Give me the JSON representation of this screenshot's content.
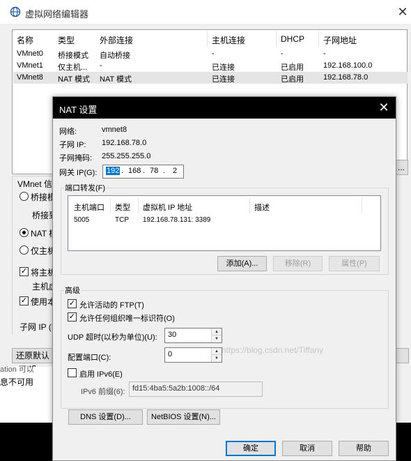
{
  "bg": {
    "title": "虚拟网络编辑器",
    "close": "✕",
    "columns": [
      "名称",
      "类型",
      "外部连接",
      "主机连接",
      "DHCP",
      "子网地址"
    ],
    "rows": [
      [
        "VMnet0",
        "桥接模式",
        "自动桥接",
        "-",
        "-",
        "-"
      ],
      [
        "VMnet1",
        "仅主机...",
        "-",
        "已连接",
        "已启用",
        "192.168.100.0"
      ],
      [
        "VMnet8",
        "NAT 模式",
        "NAT 模式",
        "已连接",
        "已启用",
        "192.168.78.0"
      ]
    ],
    "group_label": "VMnet 信息",
    "radio_bridge": "桥接模",
    "bridge_to": "桥接到",
    "radio_nat": "NAT 模",
    "radio_hostonly": "仅主机",
    "check_host": "将主机",
    "host_line2": "主机虚",
    "check_use": "使用本",
    "subnet_ip": "子网 IP (I",
    "restore_btn": "还原默认设",
    "left_partial": "ation 可以",
    "unavailable": "息不可用",
    "dots_btn": "..."
  },
  "nat": {
    "title": "NAT 设置",
    "close": "✕",
    "network_label": "网络:",
    "network_value": "vmnet8",
    "subnet_ip_label": "子网 IP:",
    "subnet_ip_value": "192.168.78.0",
    "subnet_mask_label": "子网掩码:",
    "subnet_mask_value": "255.255.255.0",
    "gateway_label": "网关 IP(G):",
    "gateway": [
      "192",
      "168",
      "78",
      "2"
    ],
    "port_forward": {
      "title": "端口转发(F)",
      "columns": [
        "主机端口",
        "类型",
        "虚拟机 IP 地址",
        "描述"
      ],
      "rows": [
        [
          "5005",
          "TCP",
          "192.168.78.131: 3389",
          ""
        ]
      ],
      "add": "添加(A)...",
      "remove": "移除(R)",
      "properties": "属性(P)"
    },
    "advanced": {
      "title": "高级",
      "allow_ftp": "允许活动的 FTP(T)",
      "allow_oui": "允许任何组织唯一标识符(O)",
      "udp_label": "UDP 超时(以秒为单位)(U):",
      "udp_value": "30",
      "config_port_label": "配置端口(C):",
      "config_port_value": "0",
      "enable_ipv6": "启用 IPv6(E)",
      "ipv6_prefix_label": "IPv6 前缀(6):",
      "ipv6_prefix_value": "fd15:4ba5:5a2b:1008::/64",
      "ftp_checked": true,
      "oui_checked": true,
      "ipv6_checked": false
    },
    "dns_btn": "DNS 设置(D)...",
    "netbios_btn": "NetBIOS 设置(N)...",
    "ok": "确定",
    "cancel": "取消",
    "help": "帮助"
  },
  "watermark": "https://blog.csdn.net/Tiffany",
  "colors": {
    "accent": "#0078d7",
    "titlebar": "#000000"
  }
}
